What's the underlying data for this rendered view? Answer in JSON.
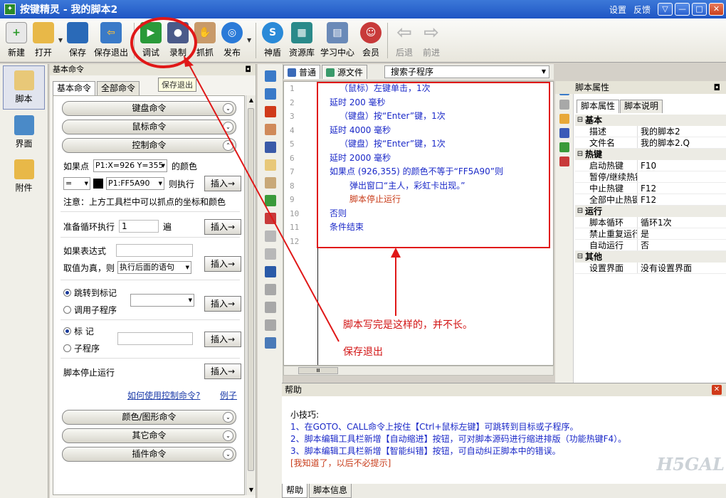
{
  "window": {
    "title": "按键精灵 - 我的脚本2",
    "links": [
      "设置",
      "反馈"
    ],
    "controls": [
      "▽",
      "—",
      "□",
      "✕"
    ]
  },
  "toolbar": {
    "buttons": [
      {
        "label": "新建",
        "icon": "new-file-icon",
        "color": "#e8e8e8"
      },
      {
        "label": "打开",
        "icon": "open-folder-icon",
        "color": "#e8b848"
      },
      {
        "label": "保存",
        "icon": "save-disk-icon",
        "color": "#2a6ab8"
      },
      {
        "label": "保存退出",
        "icon": "save-exit-icon",
        "color": "#3a7ac8"
      },
      {
        "label": "调试",
        "icon": "debug-icon",
        "color": "#2a9a3a"
      },
      {
        "label": "录制",
        "icon": "record-camera-icon",
        "color": "#4a5a8a"
      },
      {
        "label": "抓抓",
        "icon": "grab-hand-icon",
        "color": "#c89a6a"
      },
      {
        "label": "发布",
        "icon": "publish-globe-icon",
        "color": "#2a7ad8"
      },
      {
        "label": "神盾",
        "icon": "shield-icon",
        "color": "#2a8ad8"
      },
      {
        "label": "资源库",
        "icon": "resource-library-icon",
        "color": "#2a8a8a"
      },
      {
        "label": "学习中心",
        "icon": "learning-center-icon",
        "color": "#6a8ab8"
      },
      {
        "label": "会员",
        "icon": "member-icon",
        "color": "#c83a3a"
      },
      {
        "label": "后退",
        "icon": "back-arrow-icon",
        "color": "#c8c8c8"
      },
      {
        "label": "前进",
        "icon": "forward-arrow-icon",
        "color": "#c8c8c8"
      }
    ],
    "tooltip": "保存退出"
  },
  "leftnav": [
    {
      "label": "脚本",
      "icon": "script-icon",
      "color": "#e8c878"
    },
    {
      "label": "界面",
      "icon": "interface-icon",
      "color": "#4a8ac8"
    },
    {
      "label": "附件",
      "icon": "attachment-icon",
      "color": "#e8b848"
    }
  ],
  "cmdpanel": {
    "header": "基本命令",
    "tabs": [
      "基本命令",
      "全部命令"
    ],
    "categories_top": [
      "键盘命令",
      "鼠标命令",
      "控制命令"
    ],
    "categories_bottom": [
      "颜色/图形命令",
      "其它命令",
      "插件命令"
    ],
    "if_point_label": "如果点",
    "if_point_value": "P1:X=926 Y=355",
    "color_label": "的颜色",
    "op_value": "=",
    "color_value": "P1:FF5A90",
    "then_label": "则执行",
    "insert": "插入→",
    "note": "注意：上方工具栏中可以抓点的坐标和颜色",
    "loop_label": "准备循环执行",
    "loop_value": "1",
    "loop_unit": "遍",
    "expr_label": "如果表达式",
    "expr_value": "",
    "true_label": "取值为真，则",
    "true_value": "执行后面的语句",
    "jump_label": "跳转到标记",
    "call_label": "调用子程序",
    "mark_label": "标 记",
    "sub_label": "子程序",
    "stop_label": "脚本停止运行",
    "help_link": "如何使用控制命令?",
    "example_link": "例子"
  },
  "editor": {
    "tabs": [
      "普通",
      "源文件"
    ],
    "subroutine_search": "搜索子程序",
    "line_numbers": [
      "1",
      "2",
      "3",
      "4",
      "5",
      "6",
      "7",
      "8",
      "9",
      "10",
      "11",
      "12"
    ],
    "lines": [
      {
        "text": "（鼠标）左键单击，1次",
        "indent": 1
      },
      {
        "text": "延时 200 毫秒",
        "indent": 0
      },
      {
        "text": "（键盘）按“Enter”键，1次",
        "indent": 1
      },
      {
        "text": "延时 4000 毫秒",
        "indent": 0
      },
      {
        "text": "（键盘）按“Enter”键，1次",
        "indent": 1
      },
      {
        "text": "延时 2000 毫秒",
        "indent": 0
      },
      {
        "text": "如果点 (926,355) 的颜色不等于“FF5A90”则",
        "indent": 0
      },
      {
        "text": "弹出窗口“主人，彩虹卡出现。”",
        "indent": 2
      },
      {
        "text": "脚本停止运行",
        "indent": 2,
        "red": true
      },
      {
        "text": "否则",
        "indent": 0
      },
      {
        "text": "条件结束",
        "indent": 0
      }
    ],
    "scroll_thumb": "Ⅲ"
  },
  "properties": {
    "header": "脚本属性",
    "tabs": [
      "脚本属性",
      "脚本说明"
    ],
    "groups": [
      {
        "name": "基本",
        "rows": [
          {
            "k": "描述",
            "v": "我的脚本2"
          },
          {
            "k": "文件名",
            "v": "我的脚本2.Q"
          }
        ]
      },
      {
        "name": "热键",
        "rows": [
          {
            "k": "启动热键",
            "v": "F10"
          },
          {
            "k": "暂停/继续热键",
            "v": ""
          },
          {
            "k": "中止热键",
            "v": "F12"
          },
          {
            "k": "全部中止热键",
            "v": "F12"
          }
        ]
      },
      {
        "name": "运行",
        "rows": [
          {
            "k": "脚本循环",
            "v": "循环1次"
          },
          {
            "k": "禁止重复运行",
            "v": "是"
          },
          {
            "k": "自动运行",
            "v": "否"
          }
        ]
      },
      {
        "name": "其他",
        "rows": [
          {
            "k": "设置界面",
            "v": "没有设置界面"
          }
        ]
      }
    ]
  },
  "help": {
    "header": "帮助",
    "title": "小技巧:",
    "tips": [
      "1、在GOTO、CALL命令上按住【Ctrl+鼠标左键】可跳转到目标或子程序。",
      "2、脚本编辑工具栏新增【自动缩进】按钮，可对脚本源码进行缩进排版（功能热键F4）。",
      "3、脚本编辑工具栏新增【智能纠错】按钮，可自动纠正脚本中的错误。"
    ],
    "dismiss": "[我知道了，以后不必提示]",
    "tabs": [
      "帮助",
      "脚本信息"
    ],
    "watermark": "H5GAL"
  },
  "annotations": {
    "script_note": "脚本写完是这样的，并不长。",
    "save_exit_note": "保存退出",
    "color": "#d21414"
  }
}
